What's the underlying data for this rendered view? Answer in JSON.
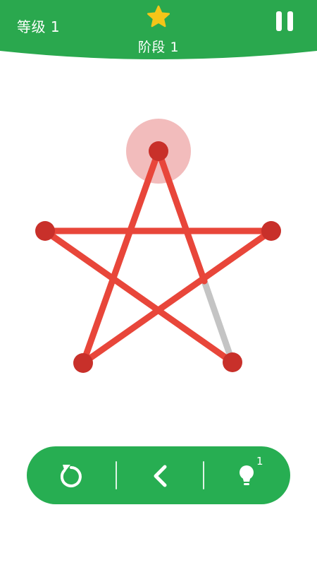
{
  "header": {
    "level_label": "等级 1",
    "stage_label": "阶段 1"
  },
  "toolbar": {
    "hint_count": "1"
  },
  "colors": {
    "green": "#27ae52",
    "header_green": "#2aa84e",
    "star_yellow": "#f5c518",
    "line_red": "#e8463a",
    "node_red": "#c8302a",
    "remaining_gray": "#c4c4c4",
    "active_halo": "#f2bcbc"
  },
  "icons": {
    "level_star": "star-icon",
    "pause": "pause-icon",
    "restart": "restart-icon",
    "back": "chevron-left-icon",
    "hint": "lightbulb-icon"
  }
}
